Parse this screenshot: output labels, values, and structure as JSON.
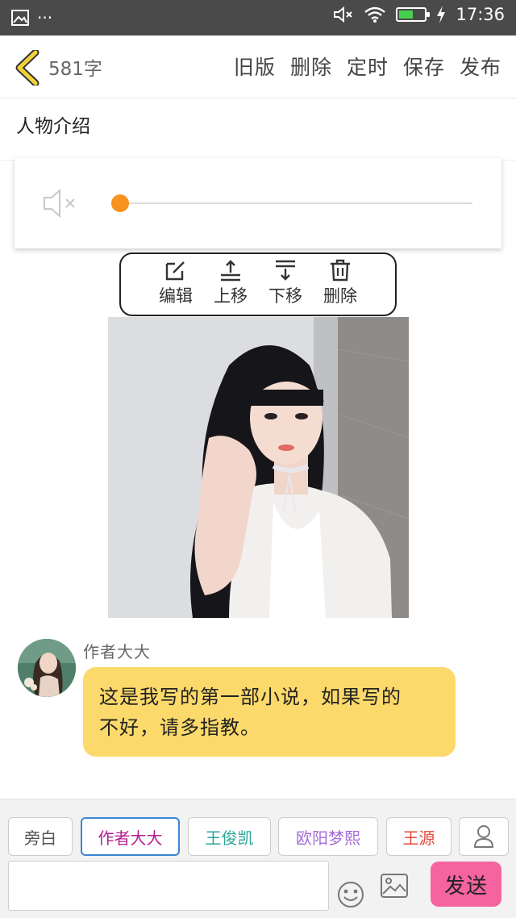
{
  "status_bar": {
    "time": "17:36",
    "dots": "···",
    "battery_level": 0.55,
    "battery_color": "#45d04f"
  },
  "header": {
    "word_count": "581字",
    "actions": [
      {
        "label": "旧版"
      },
      {
        "label": "删除"
      },
      {
        "label": "定时"
      },
      {
        "label": "保存"
      },
      {
        "label": "发布"
      }
    ],
    "back_color": "#f2d23b"
  },
  "section": {
    "title": "人物介绍"
  },
  "audio": {
    "progress": 0.0,
    "knob_color": "#f7931e"
  },
  "toolbar": {
    "items": [
      {
        "label": "编辑",
        "icon": "edit-icon"
      },
      {
        "label": "上移",
        "icon": "move-up-icon"
      },
      {
        "label": "下移",
        "icon": "move-down-icon"
      },
      {
        "label": "删除",
        "icon": "trash-icon"
      }
    ]
  },
  "message": {
    "author": "作者大大",
    "text_line1": "这是我写的第一部小说，如果写的",
    "text_line2": "不好，请多指教。",
    "bubble_color": "#fcd96b"
  },
  "roles": [
    {
      "label": "旁白",
      "color": "#555555"
    },
    {
      "label": "作者大大",
      "color": "#b21e8f",
      "active": true
    },
    {
      "label": "王俊凯",
      "color": "#2aa59a"
    },
    {
      "label": "欧阳梦熙",
      "color": "#a56ad6"
    },
    {
      "label": "王源",
      "color": "#e4483a"
    }
  ],
  "composer": {
    "placeholder": "",
    "send_label": "发送",
    "send_color": "#f564a0"
  }
}
